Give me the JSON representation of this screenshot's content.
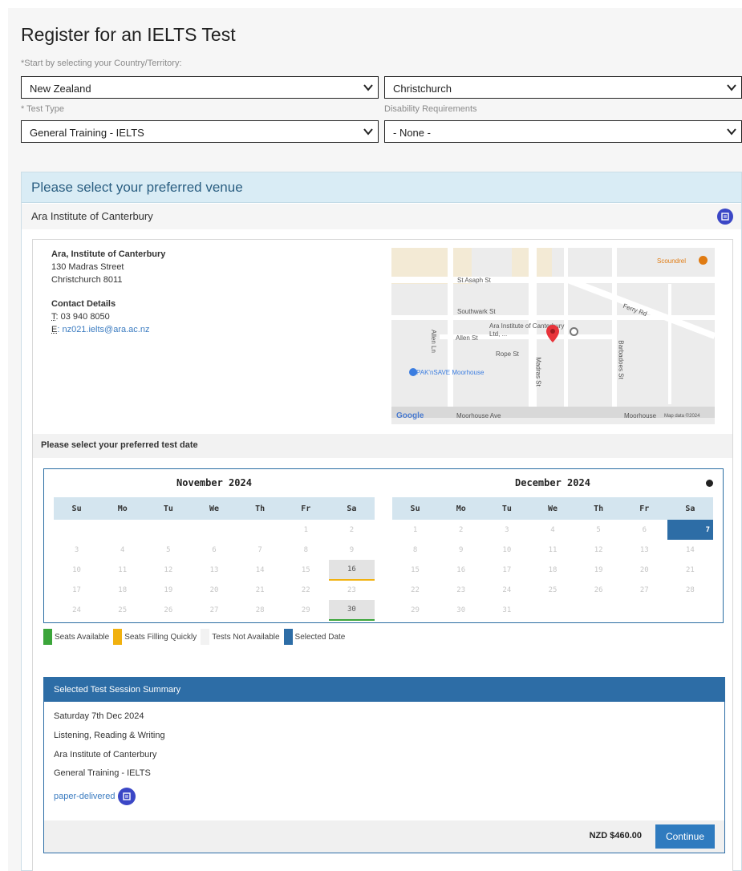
{
  "page": {
    "title": "Register for an IELTS Test"
  },
  "form": {
    "country_hint": "*Start by selecting your Country/Territory:",
    "country_value": "New Zealand",
    "city_value": "Christchurch",
    "test_type_hint": "* Test Type",
    "test_type_value": "General Training - IELTS",
    "disability_hint": "Disability Requirements",
    "disability_value": "- None -"
  },
  "venue": {
    "header": "Please select your preferred venue",
    "name": "Ara Institute of Canterbury",
    "address": {
      "title": "Ara, Institute of Canterbury",
      "line1": "130 Madras Street",
      "line2": "Christchurch 8011",
      "contact_title": "Contact Details",
      "phone_label": "T",
      "phone": ": 03 940 8050",
      "email_label": "E",
      "email": ": nz021.ielts@ara.ac.nz"
    },
    "map": {
      "labels": {
        "st_asaph": "St Asaph St",
        "southwark": "Southwark St",
        "allen": "Allen St",
        "allen_ln": "Allen Ln",
        "ara": "Ara Institute of Canterbury Ltd, ...",
        "rope": "Rope St",
        "paknsave": "PAK'nSAVE Moorhouse",
        "madras": "Madras St",
        "barbadoes": "Barbadoes St",
        "ferry": "Ferry Rd",
        "moorhouse": "Moorhouse Ave",
        "moorhouse2": "Moorhouse",
        "scoundrel": "Scoundrel",
        "google": "Google",
        "mapdata": "Map data ©2024"
      },
      "colors": {
        "road": "#ffffff",
        "land": "#ececec",
        "zone": "#f3ead5",
        "pin": "#e8333a"
      }
    }
  },
  "dates": {
    "prompt": "Please select your preferred test date",
    "weekdays": [
      "Su",
      "Mo",
      "Tu",
      "We",
      "Th",
      "Fr",
      "Sa"
    ],
    "november": {
      "title": "November 2024"
    },
    "december": {
      "title": "December 2024"
    }
  },
  "legend": {
    "seats": "Seats Available",
    "filling": "Seats Filling Quickly",
    "unavailable": "Tests Not Available",
    "selected": "Selected Date",
    "colors": {
      "seats": "#3ba53a",
      "filling": "#f1b10f",
      "unavailable": "#f2f2f2",
      "selected": "#2d6da6"
    }
  },
  "summary": {
    "header": "Selected Test Session Summary",
    "date": "Saturday 7th Dec 2024",
    "modules": "Listening, Reading & Writing",
    "venue": "Ara Institute of Canterbury",
    "type": "General Training - IELTS",
    "delivery": "paper-delivered",
    "price": "NZD $460.00",
    "continue": "Continue"
  }
}
